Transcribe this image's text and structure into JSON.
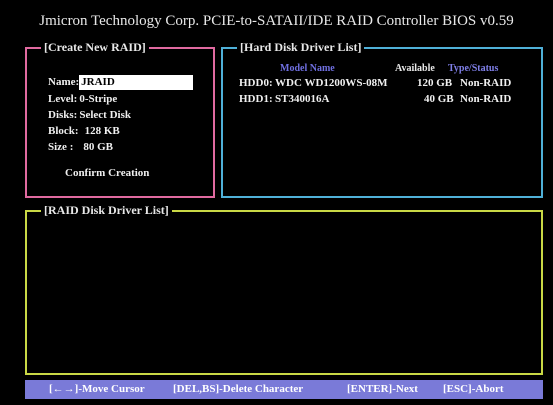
{
  "title": "Jmicron Technology Corp. PCIE-to-SATAII/IDE RAID Controller BIOS v0.59",
  "create_panel": {
    "label": "[Create New RAID]",
    "name_label": "Name:",
    "name_value": "JRAID",
    "level_label": "Level:",
    "level_value": "0-Stripe",
    "disks_label": "Disks:",
    "disks_value": "Select Disk",
    "block_label": "Block:",
    "block_value": "128 KB",
    "size_label": "Size :",
    "size_value": "80 GB",
    "confirm": "Confirm Creation"
  },
  "hdd_panel": {
    "label": "[Hard Disk Driver List]",
    "col_model": "Model Name",
    "col_available": "Available",
    "col_type": "Type/Status",
    "rows": [
      {
        "id": "HDD0:",
        "model": "WDC WD1200WS-08M",
        "available": "120 GB",
        "type": "Non-RAID"
      },
      {
        "id": "HDD1:",
        "model": "ST340016A",
        "available": "40 GB",
        "type": "Non-RAID"
      }
    ]
  },
  "raid_panel": {
    "label": "[RAID Disk Driver List]"
  },
  "statusbar": {
    "move": "[←→]-Move Cursor",
    "delete": "[DEL,BS]-Delete Character",
    "next": "[ENTER]-Next",
    "abort": "[ESC]-Abort"
  },
  "colors": {
    "create_border": "#e06aa0",
    "hdd_border": "#4fb0d8",
    "raid_border": "#c9d845",
    "statusbar_bg": "#7a7ad8",
    "header_model": "#6f6fe0",
    "header_type": "#7f7fe8"
  }
}
